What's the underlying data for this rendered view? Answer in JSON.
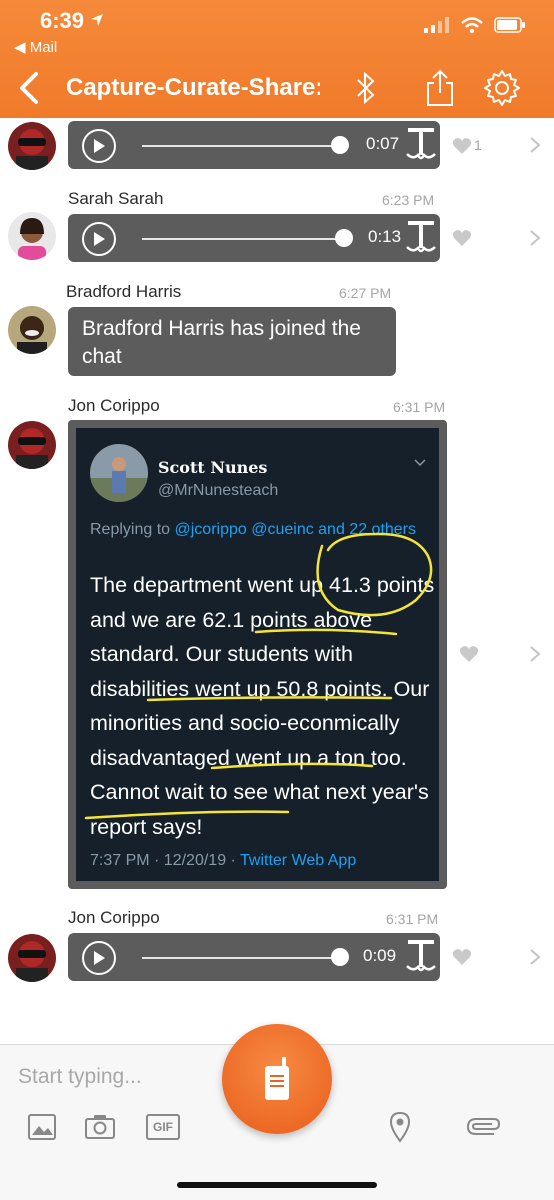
{
  "status": {
    "time": "6:39",
    "back_app": "◀ Mail"
  },
  "header": {
    "title": "Capture-Curate-Share: M"
  },
  "messages": [
    {
      "type": "audio",
      "duration": "0:07",
      "likes": "1"
    },
    {
      "sender": "Sarah Sarah",
      "time": "6:23 PM",
      "type": "audio",
      "duration": "0:13"
    },
    {
      "sender": "Bradford Harris",
      "time": "6:27 PM",
      "type": "text",
      "text": "Bradford Harris has joined the chat"
    },
    {
      "sender": "Jon Corippo",
      "time": "6:31 PM",
      "type": "tweet"
    },
    {
      "sender": "Jon Corippo",
      "time": "6:31 PM",
      "type": "audio",
      "duration": "0:09"
    }
  ],
  "tweet": {
    "name": "Scott Nunes",
    "handle": "@MrNunesteach",
    "reply_prefix": "Replying to ",
    "reply_targets": "@jcorippo @cueinc and 22 others",
    "body": "The department went up 41.3 points and we are 62.1 points above standard. Our students with disabilities went up 50.8 points. Our minorities and socio-econmically disadvantaged went up a ton too. Cannot wait to see what next year's report says!",
    "timestamp": "7:37 PM · 12/20/19 · ",
    "source": "Twitter Web App"
  },
  "composer": {
    "placeholder": "Start typing...",
    "gif_label": "GIF"
  },
  "colors": {
    "brand_orange": "#f07a2a",
    "bubble": "#5c5c5c",
    "tweet_bg": "#15202b",
    "link": "#1da1f2",
    "ink_yellow": "#f3e43a"
  }
}
